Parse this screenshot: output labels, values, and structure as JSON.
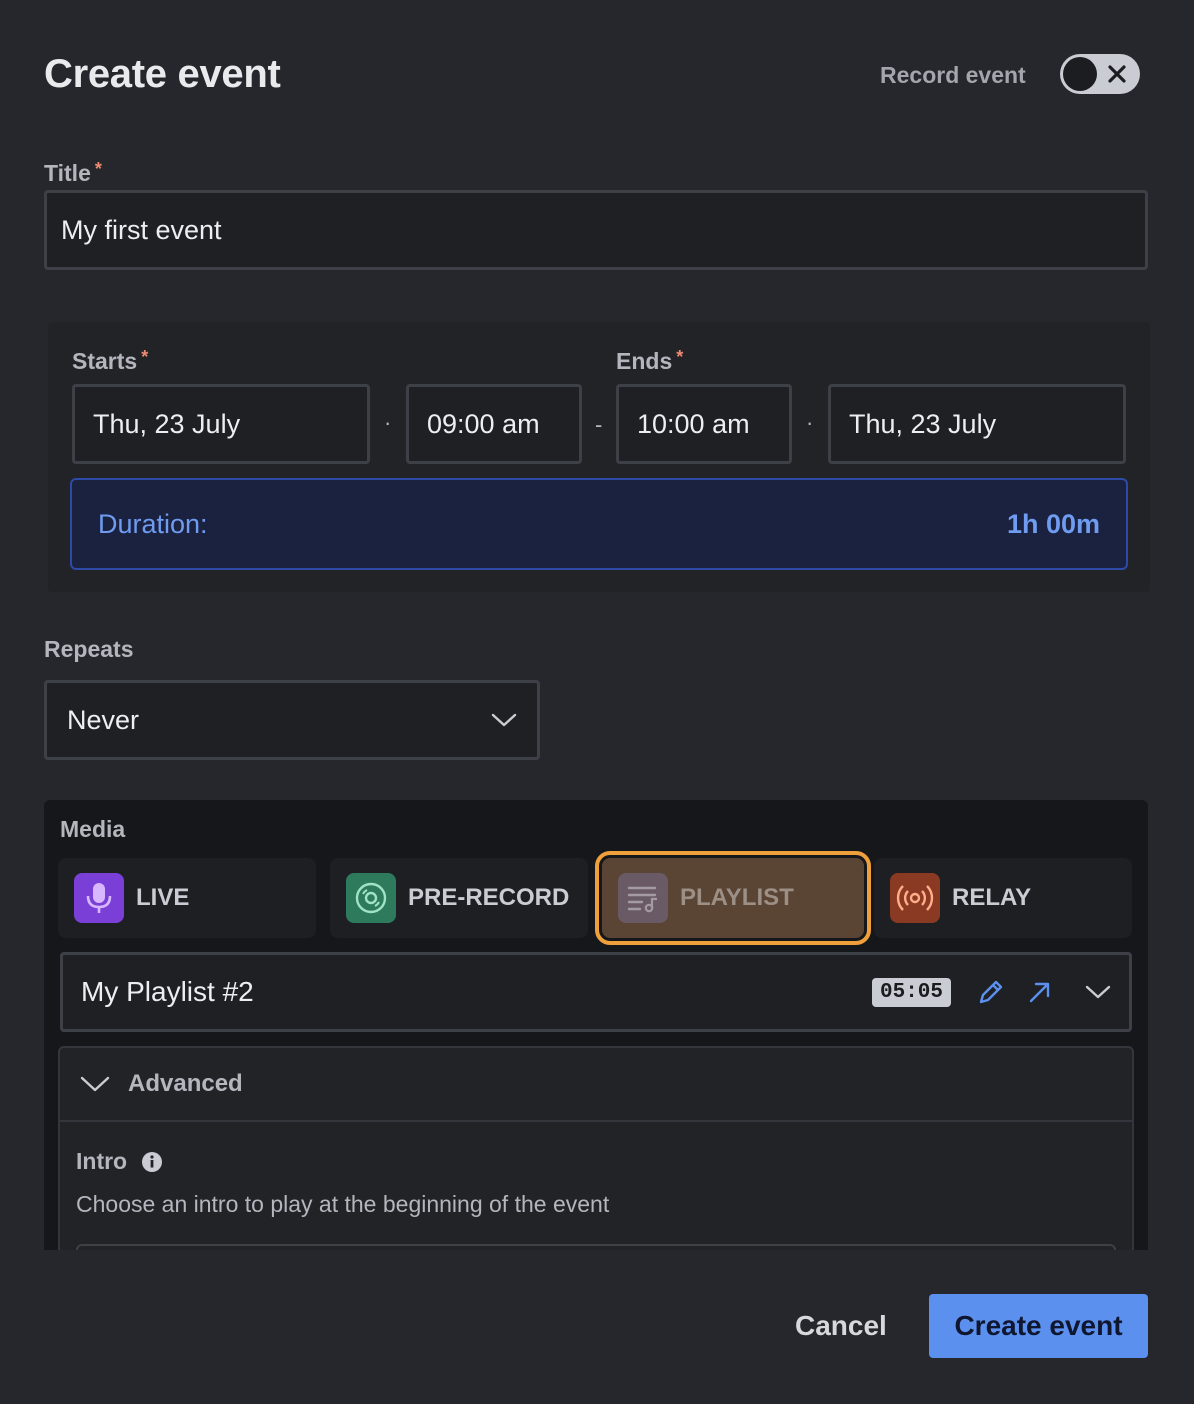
{
  "header": {
    "title": "Create event",
    "record_label": "Record event",
    "record_enabled": false
  },
  "title_field": {
    "label": "Title",
    "required_mark": "*",
    "value": "My first event"
  },
  "schedule": {
    "starts_label": "Starts",
    "ends_label": "Ends",
    "required_mark": "*",
    "start_date": "Thu, 23 July",
    "start_time": "09:00 am",
    "end_time": "10:00 am",
    "end_date": "Thu, 23 July",
    "dot_sep": "·",
    "dash_sep": "-",
    "duration_label": "Duration:",
    "duration_value": "1h 00m"
  },
  "repeats": {
    "label": "Repeats",
    "value": "Never"
  },
  "media": {
    "label": "Media",
    "tabs": [
      {
        "label": "LIVE",
        "icon": "microphone-icon",
        "color": "#7a3fd6"
      },
      {
        "label": "PRE-RECORD",
        "icon": "disc-icon",
        "color": "#2e7a5c"
      },
      {
        "label": "PLAYLIST",
        "icon": "playlist-icon",
        "color": "#6a5a66",
        "active": true
      },
      {
        "label": "RELAY",
        "icon": "broadcast-icon",
        "color": "#8a3a22"
      }
    ],
    "playlist": {
      "name": "My Playlist #2",
      "duration": "05:05"
    },
    "advanced": {
      "label": "Advanced",
      "intro_label": "Intro",
      "intro_desc": "Choose an intro to play at the beginning of the event"
    }
  },
  "footer": {
    "cancel_label": "Cancel",
    "create_label": "Create event"
  },
  "colors": {
    "accent": "#5b90ee",
    "highlight": "#f0a03a",
    "required": "#f08a73"
  }
}
